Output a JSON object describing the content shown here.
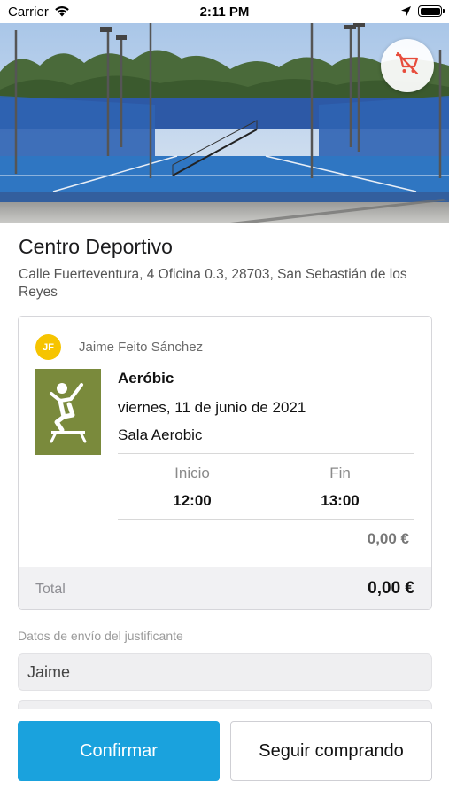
{
  "status_bar": {
    "carrier": "Carrier",
    "time": "2:11 PM"
  },
  "header": {
    "cart_icon": "cart-off-icon"
  },
  "venue": {
    "name": "Centro Deportivo",
    "address": "Calle Fuerteventura, 4 Oficina 0.3, 28703, San Sebastián de los Reyes"
  },
  "booking": {
    "user_initials": "JF",
    "user_name": "Jaime Feito Sánchez",
    "activity_icon": "aerobics-person-icon",
    "activity": "Aeróbic",
    "date": "viernes, 11 de junio de 2021",
    "room": "Sala Aerobic",
    "start_label": "Inicio",
    "end_label": "Fin",
    "start_time": "12:00",
    "end_time": "13:00",
    "price": "0,00 €",
    "total_label": "Total",
    "total_value": "0,00 €"
  },
  "form": {
    "section_label": "Datos de envío del justificante",
    "name_value": "Jaime",
    "second_value": ""
  },
  "actions": {
    "confirm_label": "Confirmar",
    "continue_label": "Seguir comprando"
  },
  "colors": {
    "primary": "#1aa2dd",
    "avatar": "#f6c400",
    "activity_tile": "#7a8a3c",
    "cart_icon": "#e74c3c"
  }
}
